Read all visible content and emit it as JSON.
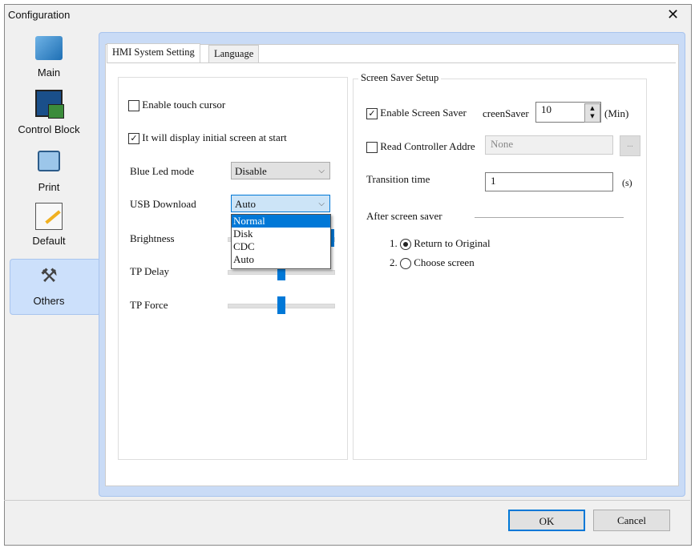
{
  "window": {
    "title": "Configuration",
    "close": "✕"
  },
  "sidebar": {
    "items": [
      {
        "label": "Main"
      },
      {
        "label": "Control Block"
      },
      {
        "label": "Print"
      },
      {
        "label": "Default"
      },
      {
        "label": "Others"
      }
    ],
    "selected": "Others"
  },
  "tabs": [
    {
      "label": "HMI System Setting",
      "active": true
    },
    {
      "label": "Language",
      "active": false
    }
  ],
  "left": {
    "enable_touch_cursor": {
      "label": "Enable touch cursor",
      "checked": false
    },
    "display_initial": {
      "label": "It will display initial screen at start",
      "checked": true
    },
    "blue_led": {
      "label": "Blue Led mode",
      "value": "Disable"
    },
    "usb_download": {
      "label": "USB Download",
      "value": "Auto",
      "options": [
        "Normal",
        "Disk",
        "CDC",
        "Auto"
      ],
      "highlighted": "Normal"
    },
    "brightness": {
      "label": "Brightness"
    },
    "tp_delay": {
      "label": "TP Delay",
      "value_fraction": 0.5
    },
    "tp_force": {
      "label": "TP Force",
      "value_fraction": 0.5
    }
  },
  "screensaver": {
    "legend": "Screen Saver Setup",
    "enable": {
      "label": "Enable Screen Saver",
      "checked": true
    },
    "time_label": "creenSaver",
    "time_value": "10",
    "time_unit": "(Min)",
    "read_controller": {
      "label": "Read Controller Addre",
      "checked": false,
      "value": "None",
      "browse": "..."
    },
    "transition": {
      "label": "Transition time",
      "value": "1",
      "unit": "(s)"
    },
    "after_label": "After screen saver",
    "options": [
      {
        "num": "1.",
        "label": "Return to Original",
        "selected": true
      },
      {
        "num": "2.",
        "label": "Choose screen",
        "selected": false
      }
    ]
  },
  "buttons": {
    "ok": "OK",
    "cancel": "Cancel"
  },
  "colors": {
    "accent": "#0078d7",
    "panel": "#c9dbf6",
    "selected_nav": "#cce0fb"
  }
}
